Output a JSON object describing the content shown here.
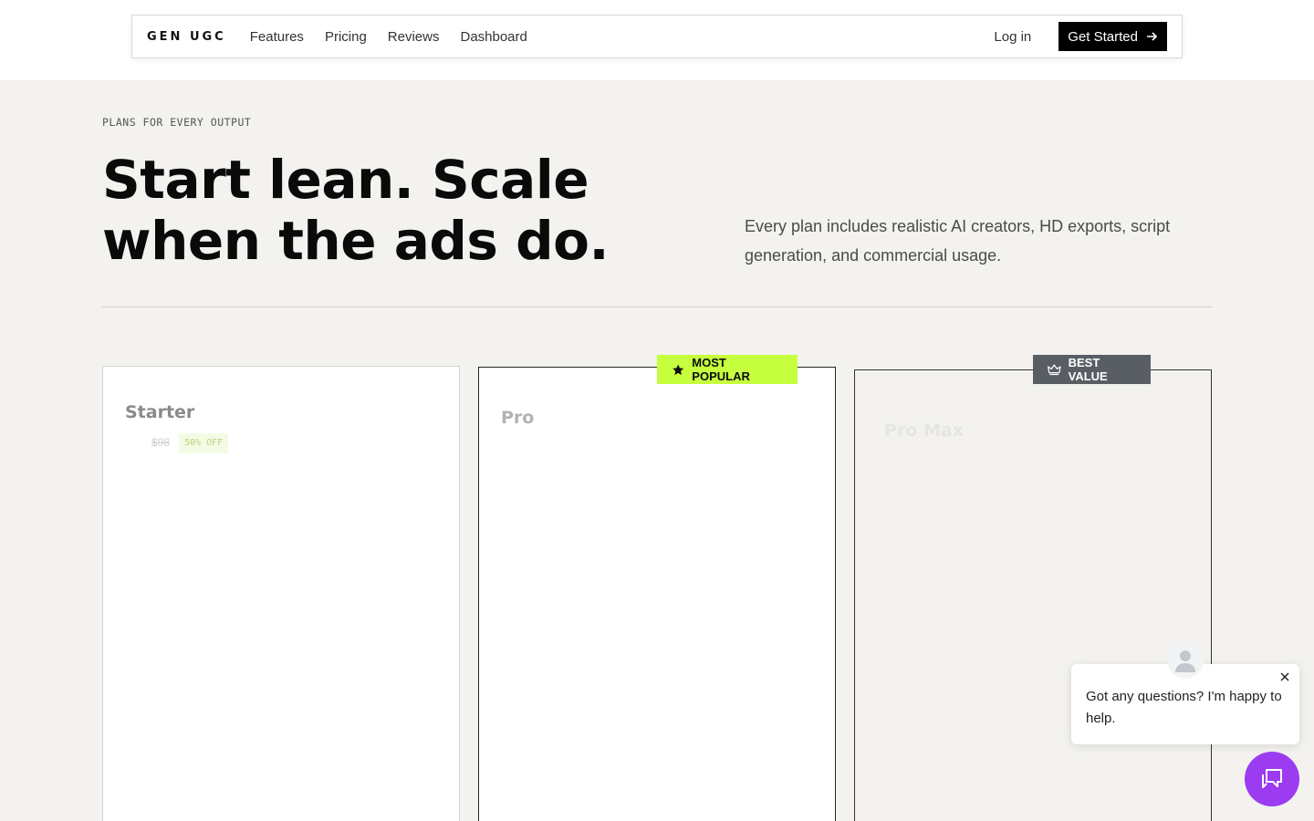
{
  "nav": {
    "logo": "GEN UGC",
    "links": [
      "Features",
      "Pricing",
      "Reviews",
      "Dashboard"
    ],
    "login": "Log in",
    "cta": "Get Started"
  },
  "hero": {
    "eyebrow": "PLANS FOR EVERY OUTPUT",
    "headline": "Start lean. Scale when the ads do.",
    "subcopy": "Every plan includes realistic AI creators, HD exports, script generation, and commercial usage."
  },
  "plans": [
    {
      "name": "Starter",
      "old_price": "$98",
      "discount": "50% OFF"
    },
    {
      "name": "Pro",
      "badge": "MOST POPULAR"
    },
    {
      "name": "Pro Max",
      "badge": "BEST VALUE"
    }
  ],
  "chat": {
    "message": "Got any questions? I'm happy to help."
  },
  "colors": {
    "accent_lime": "#c6ff3d",
    "chat_purple": "#9b3cf0",
    "badge_gray": "#595d64",
    "page_bg": "#f3f2ef"
  },
  "icons": [
    "arrow-right-icon",
    "star-icon",
    "crown-icon",
    "user-avatar-icon",
    "close-icon",
    "chat-icon"
  ]
}
